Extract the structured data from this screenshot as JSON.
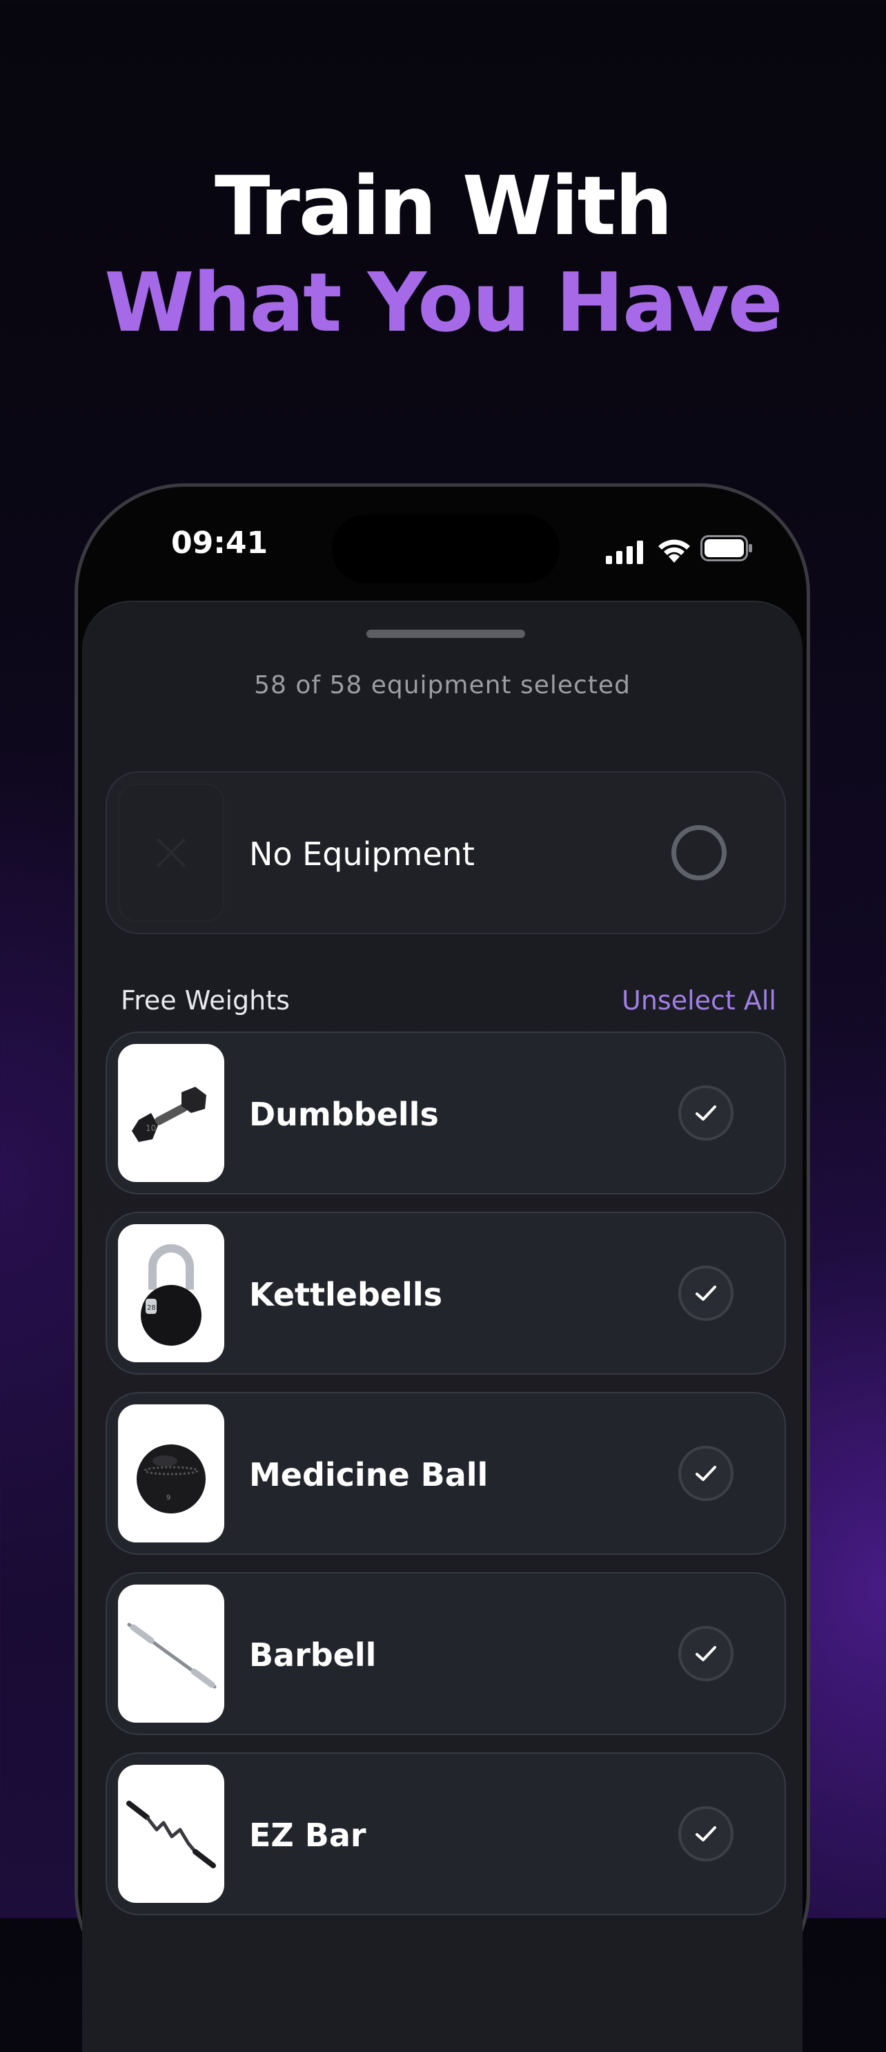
{
  "headline": {
    "line1": "Train With",
    "line2": "What You Have"
  },
  "status_bar": {
    "time": "09:41"
  },
  "sheet": {
    "count_text": "58 of 58 equipment selected",
    "no_equipment": {
      "label": "No Equipment",
      "selected": false
    },
    "section": {
      "title": "Free Weights",
      "action": "Unselect All"
    },
    "items": [
      {
        "label": "Dumbbells",
        "image": "dumbbell-image",
        "selected": true
      },
      {
        "label": "Kettlebells",
        "image": "kettlebell-image",
        "selected": true
      },
      {
        "label": "Medicine Ball",
        "image": "medicine-ball-image",
        "selected": true
      },
      {
        "label": "Barbell",
        "image": "barbell-image",
        "selected": true
      },
      {
        "label": "EZ Bar",
        "image": "ez-bar-image",
        "selected": true
      }
    ]
  },
  "colors": {
    "accent": "#a66ae8",
    "link": "#a080e6",
    "card": "#23252c"
  }
}
